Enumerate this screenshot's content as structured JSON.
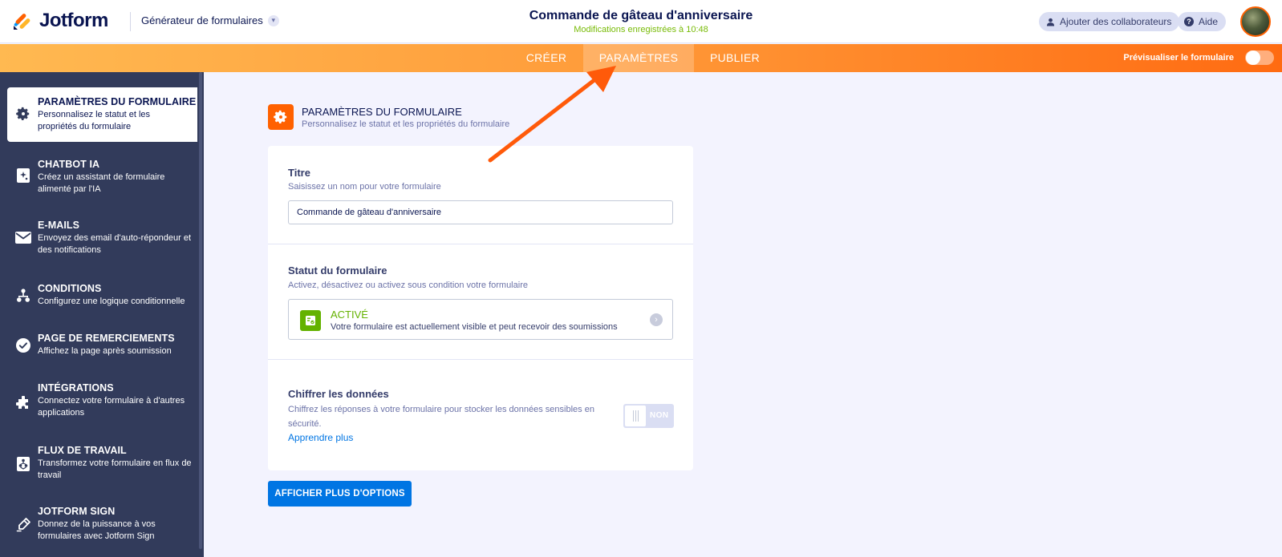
{
  "header": {
    "brand": "Jotform",
    "builder_menu": "Générateur de formulaires",
    "form_title": "Commande de gâteau d'anniversaire",
    "saved_status": "Modifications enregistrées à 10:48",
    "add_collaborators": "Ajouter des collaborateurs",
    "help": "Aide"
  },
  "tabs": [
    {
      "label": "CRÉER",
      "active": false
    },
    {
      "label": "PARAMÈTRES",
      "active": true
    },
    {
      "label": "PUBLIER",
      "active": false
    }
  ],
  "preview": {
    "label": "Prévisualiser le formulaire",
    "enabled": false
  },
  "sidebar": {
    "items": [
      {
        "title": "PARAMÈTRES DU FORMULAIRE",
        "desc": "Personnalisez le statut et les propriétés du formulaire",
        "icon": "gear-icon",
        "active": true
      },
      {
        "title": "CHATBOT IA",
        "desc": "Créez un assistant de formulaire alimenté par l'IA",
        "icon": "chatbot-icon",
        "active": false
      },
      {
        "title": "E-MAILS",
        "desc": "Envoyez des email d'auto-répondeur et des notifications",
        "icon": "envelope-icon",
        "active": false
      },
      {
        "title": "CONDITIONS",
        "desc": "Configurez une logique conditionnelle",
        "icon": "conditions-icon",
        "active": false
      },
      {
        "title": "PAGE DE REMERCIEMENTS",
        "desc": "Affichez la page après soumission",
        "icon": "check-circle-icon",
        "active": false
      },
      {
        "title": "INTÉGRATIONS",
        "desc": "Connectez votre formulaire à d'autres applications",
        "icon": "puzzle-icon",
        "active": false
      },
      {
        "title": "FLUX DE TRAVAIL",
        "desc": "Transformez votre formulaire en flux de travail",
        "icon": "workflow-icon",
        "active": false
      },
      {
        "title": "JOTFORM SIGN",
        "desc": "Donnez de la puissance à vos formulaires avec Jotform Sign",
        "icon": "pen-icon",
        "active": false
      }
    ]
  },
  "section": {
    "title": "PARAMÈTRES DU FORMULAIRE",
    "subtitle": "Personnalisez le statut et les propriétés du formulaire"
  },
  "title_field": {
    "label": "Titre",
    "sub": "Saisissez un nom pour votre formulaire",
    "value": "Commande de gâteau d'anniversaire"
  },
  "status_field": {
    "label": "Statut du formulaire",
    "sub": "Activez, désactivez ou activez sous condition votre formulaire",
    "status_title": "ACTIVÉ",
    "status_desc": "Votre formulaire est actuellement visible et peut recevoir des soumissions"
  },
  "encrypt_field": {
    "label": "Chiffrer les données",
    "desc": "Chiffrez les réponses à votre formulaire pour stocker les données sensibles en sécurité.",
    "learn_more": "Apprendre plus",
    "toggle_label": "NON",
    "enabled": false
  },
  "more_options_button": "AFFICHER PLUS D'OPTIONS",
  "colors": {
    "brand_orange": "#ff6100",
    "sidebar_bg": "#323b5b",
    "accent_blue": "#0075e3",
    "success_green": "#64b200",
    "annotation_arrow": "#ff5a0a"
  }
}
